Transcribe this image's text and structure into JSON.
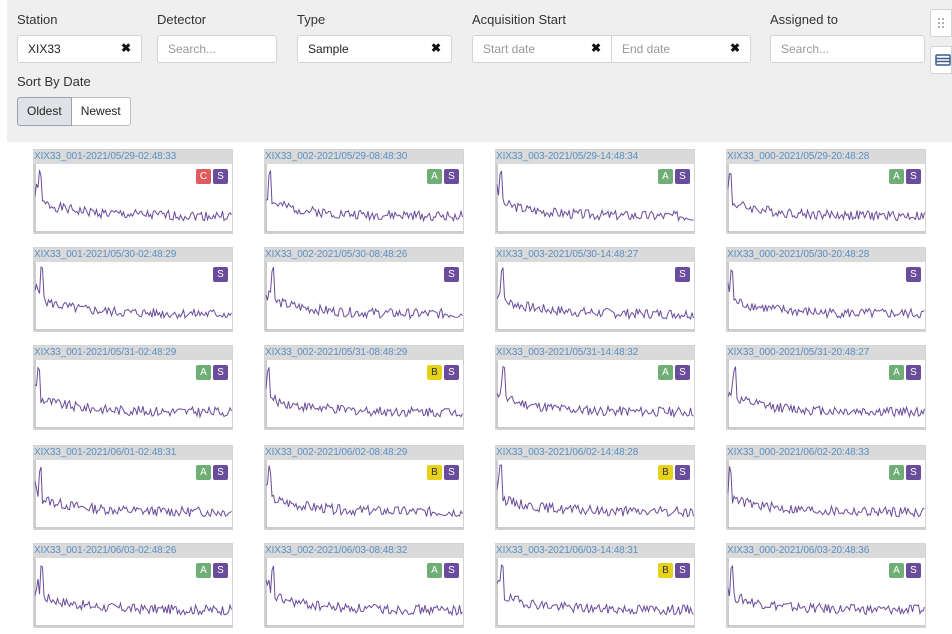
{
  "filters": {
    "station": {
      "label": "Station",
      "value": "XIX33"
    },
    "detector": {
      "label": "Detector",
      "placeholder": "Search..."
    },
    "type": {
      "label": "Type",
      "value": "Sample"
    },
    "acquisition": {
      "label": "Acquisition Start",
      "start_placeholder": "Start date",
      "end_placeholder": "End date"
    },
    "assigned": {
      "label": "Assigned to",
      "placeholder": "Search..."
    },
    "sort": {
      "label": "Sort By Date",
      "oldest": "Oldest",
      "newest": "Newest",
      "active": "Oldest"
    }
  },
  "badge_colors": {
    "C": "#e05b5b",
    "A": "#6fae74",
    "B": "#e6d21a",
    "S": "#6a4c9c"
  },
  "line_color": "#6a4c9c",
  "tiles": [
    {
      "title": "XIX33_001-2021/05/29-02:48:33",
      "badges": [
        "C",
        "S"
      ]
    },
    {
      "title": "XIX33_002-2021/05/29-08:48:30",
      "badges": [
        "A",
        "S"
      ]
    },
    {
      "title": "XIX33_003-2021/05/29-14:48:34",
      "badges": [
        "A",
        "S"
      ]
    },
    {
      "title": "XIX33_000-2021/05/29-20:48:28",
      "badges": [
        "A",
        "S"
      ]
    },
    {
      "title": "XIX33_001-2021/05/30-02:48:29",
      "badges": [
        "S"
      ]
    },
    {
      "title": "XIX33_002-2021/05/30-08:48:26",
      "badges": [
        "S"
      ]
    },
    {
      "title": "XIX33_003-2021/05/30-14:48:27",
      "badges": [
        "S"
      ]
    },
    {
      "title": "XIX33_000-2021/05/30-20:48:28",
      "badges": [
        "S"
      ]
    },
    {
      "title": "XIX33_001-2021/05/31-02:48:29",
      "badges": [
        "A",
        "S"
      ]
    },
    {
      "title": "XIX33_002-2021/05/31-08:48:29",
      "badges": [
        "B",
        "S"
      ]
    },
    {
      "title": "XIX33_003-2021/05/31-14:48:32",
      "badges": [
        "A",
        "S"
      ]
    },
    {
      "title": "XIX33_000-2021/05/31-20:48:27",
      "badges": [
        "A",
        "S"
      ]
    },
    {
      "title": "XIX33_001-2021/06/01-02:48:31",
      "badges": [
        "A",
        "S"
      ]
    },
    {
      "title": "XIX33_002-2021/06/02-08:48:29",
      "badges": [
        "B",
        "S"
      ]
    },
    {
      "title": "XIX33_003-2021/06/02-14:48:28",
      "badges": [
        "B",
        "S"
      ]
    },
    {
      "title": "XIX33_000-2021/06/02-20:48:33",
      "badges": [
        "A",
        "S"
      ]
    },
    {
      "title": "XIX33_001-2021/06/03-02:48:26",
      "badges": [
        "A",
        "S"
      ]
    },
    {
      "title": "XIX33_002-2021/06/03-08:48:32",
      "badges": [
        "A",
        "S"
      ]
    },
    {
      "title": "XIX33_003-2021/06/03-14:48:31",
      "badges": [
        "B",
        "S"
      ]
    },
    {
      "title": "XIX33_000-2021/06/03-20:48:36",
      "badges": [
        "A",
        "S"
      ]
    }
  ]
}
